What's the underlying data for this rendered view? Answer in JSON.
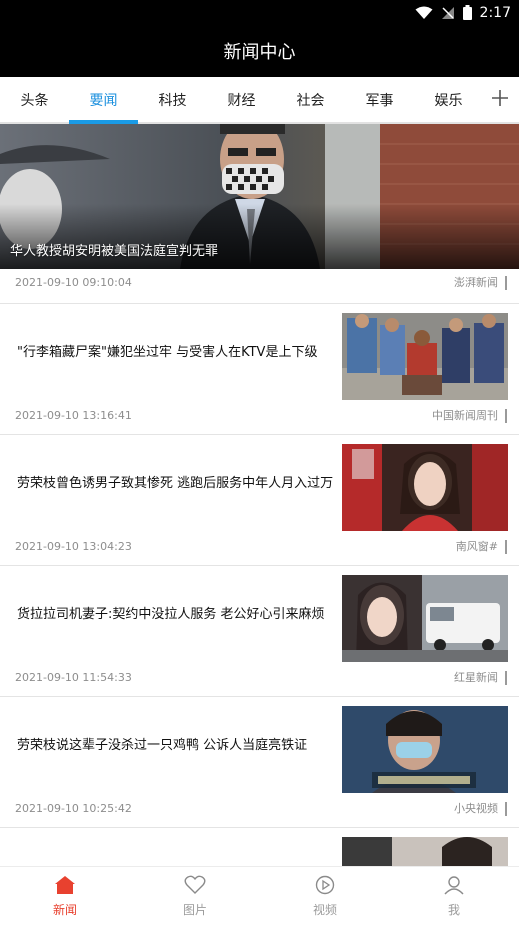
{
  "status_bar": {
    "time": "2:17"
  },
  "app": {
    "title": "新闻中心"
  },
  "tabs": [
    {
      "label": "头条",
      "active": false
    },
    {
      "label": "要闻",
      "active": true
    },
    {
      "label": "科技",
      "active": false
    },
    {
      "label": "财经",
      "active": false
    },
    {
      "label": "社会",
      "active": false
    },
    {
      "label": "军事",
      "active": false
    },
    {
      "label": "娱乐",
      "active": false
    }
  ],
  "hero": {
    "caption": "华人教授胡安明被美国法庭宣判无罪",
    "time": "2021-09-10 09:10:04",
    "source": "澎湃新闻"
  },
  "articles": [
    {
      "headline": "\"行李箱藏尸案\"嫌犯坐过牢 与受害人在KTV是上下级",
      "time": "2021-09-10 13:16:41",
      "source": "中国新闻周刊"
    },
    {
      "headline": "劳荣枝曾色诱男子致其惨死 逃跑后服务中年人月入过万",
      "time": "2021-09-10 13:04:23",
      "source": "南风窗#"
    },
    {
      "headline": "货拉拉司机妻子:契约中没拉人服务 老公好心引来麻烦",
      "time": "2021-09-10 11:54:33",
      "source": "红星新闻"
    },
    {
      "headline": "劳荣枝说这辈子没杀过一只鸡鸭 公诉人当庭亮铁证",
      "time": "2021-09-10 10:25:42",
      "source": "小央视频"
    }
  ],
  "bottom_nav": [
    {
      "label": "新闻",
      "icon": "home-icon",
      "active": true
    },
    {
      "label": "图片",
      "icon": "heart-icon",
      "active": false
    },
    {
      "label": "视频",
      "icon": "play-icon",
      "active": false
    },
    {
      "label": "我",
      "icon": "user-icon",
      "active": false
    }
  ],
  "colors": {
    "accent_tab": "#1a8fde",
    "accent_nav": "#e8412f",
    "header_bg": "#000000"
  }
}
